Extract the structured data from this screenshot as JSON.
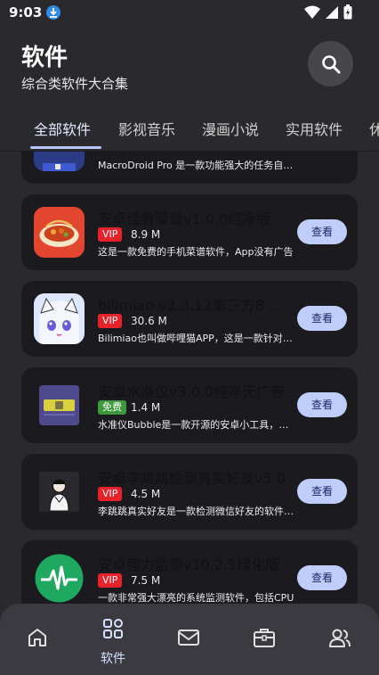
{
  "status_bar": {
    "time": "9:03"
  },
  "header": {
    "title": "软件",
    "subtitle": "综合类软件大合集"
  },
  "tabs": [
    {
      "label": "全部软件"
    },
    {
      "label": "影视音乐"
    },
    {
      "label": "漫画小说"
    },
    {
      "label": "实用软件"
    },
    {
      "label": "休"
    }
  ],
  "apps": [
    {
      "title": "",
      "badge": "",
      "size": "",
      "desc": "MacroDroid Pro 是一款功能强大的任务自动化工具",
      "button": "查看"
    },
    {
      "title": "安卓佳肴菜谱v1.0.0纯净版",
      "badge": "VIP",
      "size": "8.9 M",
      "desc": "这是一款免费的手机菜谱软件，App没有广告",
      "button": "查看"
    },
    {
      "title": "bilimiao v2.3.12第三方B站客户端",
      "badge": "VIP",
      "size": "30.6 M",
      "desc": "Bilimiao也叫做哔哩猫APP，这是一款针对B站",
      "button": "查看"
    },
    {
      "title": "安卓水准仪v3.0.0纯净无广告",
      "badge": "免费",
      "size": "1.4 M",
      "desc": "水准仪Bubble是一款开源的安卓小工具，可以",
      "button": "查看"
    },
    {
      "title": "安卓李跳跳检测真实好友v5.0",
      "badge": "VIP",
      "size": "4.5 M",
      "desc": "李跳跳真实好友是一款检测微信好友的软件工具",
      "button": "查看"
    },
    {
      "title": "安卓强力监测v10.2.1绿化版",
      "badge": "VIP",
      "size": "7.5 M",
      "desc": "一款非常强大漂亮的系统监测软件，包括CPU",
      "button": "查看"
    }
  ],
  "bottom_nav": {
    "active_label": "软件"
  },
  "icons": {
    "status": [
      "download-icon",
      "wifi-icon",
      "signal-icon",
      "battery-icon"
    ],
    "search": "search-icon",
    "nav": [
      "home-icon",
      "apps-icon",
      "mail-icon",
      "toolbox-icon",
      "users-icon"
    ]
  },
  "colors": {
    "background": "#2a2a2e",
    "card": "#1b1b1f",
    "accent": "#bfcdfb",
    "vip": "#e8222a",
    "free": "#3c9a3c",
    "nav": "#3a3a40"
  }
}
